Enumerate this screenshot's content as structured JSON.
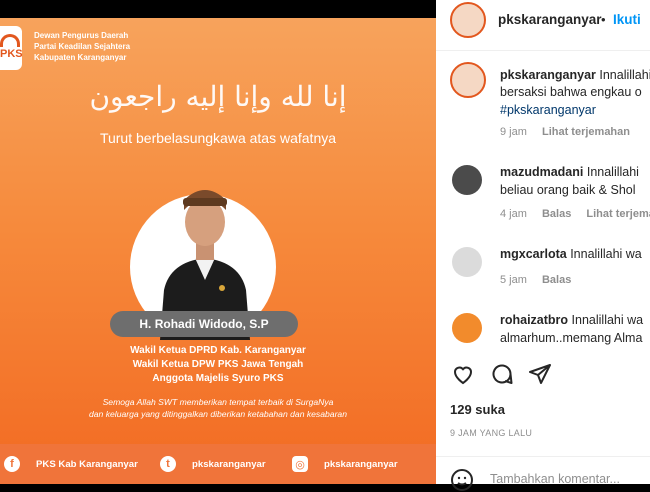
{
  "post": {
    "org_lines": [
      "Dewan Pengurus Daerah",
      "Partai Keadilan Sejahtera",
      "Kabupaten Karanganyar"
    ],
    "logo_text": "PKS",
    "arabic": "إنا لله وإنا إليه راجعون",
    "subtitle": "Turut berbelasungkawa atas wafatnya",
    "name": "H. Rohadi Widodo, S.P",
    "roles": [
      "Wakil Ketua DPRD Kab. Karanganyar",
      "Wakil Ketua DPW PKS Jawa Tengah",
      "Anggota Majelis Syuro PKS"
    ],
    "prayer": [
      "Semoga Allah SWT memberikan tempat terbaik di SurgaNya",
      "dan keluarga yang ditinggalkan diberikan ketabahan dan kesabaran"
    ],
    "socials": [
      {
        "icon": "facebook-icon",
        "glyph": "f",
        "label": "PKS Kab Karanganyar"
      },
      {
        "icon": "twitter-icon",
        "glyph": "t",
        "label": "pkskaranganyar"
      },
      {
        "icon": "instagram-icon",
        "glyph": "◎",
        "label": "pkskaranganyar"
      }
    ]
  },
  "header": {
    "username": "pkskaranganyar",
    "dot": "•",
    "follow": "Ikuti"
  },
  "caption": {
    "username": "pkskaranganyar",
    "line1": "Innalillahi",
    "line2": "bersaksi bahwa engkau o",
    "hashtag": "#pkskaranganyar",
    "time": "9 jam",
    "translate": "Lihat terjemahan"
  },
  "comments": [
    {
      "username": "mazudmadani",
      "text1": "Innalillahi",
      "text2": "beliau orang baik & Shol",
      "time": "4 jam",
      "reply": "Balas",
      "translate": "Lihat terjemah"
    },
    {
      "username": "mgxcarlota",
      "text1": "Innalillahi wa",
      "text2": "",
      "time": "5 jam",
      "reply": "Balas",
      "translate": ""
    },
    {
      "username": "rohaizatbro",
      "text1": "Innalillahi wa",
      "text2": "almarhum..memang Alma",
      "time": "",
      "reply": "",
      "translate": ""
    }
  ],
  "actions": {
    "like_icon": "heart-icon",
    "comment_icon": "comment-icon",
    "share_icon": "share-icon"
  },
  "likes": "129 suka",
  "posted": "9 JAM YANG LALU",
  "add_comment": "Tambahkan komentar..."
}
